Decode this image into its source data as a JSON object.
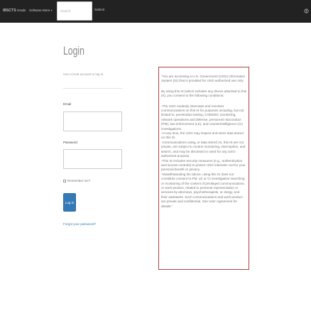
{
  "navbar": {
    "brand": "IBSCTS",
    "links": [
      "Grads",
      "Software",
      "More"
    ],
    "search_placeholder": "Search",
    "submit_label": "Submit",
    "help_icon": "help-circle-icon"
  },
  "login": {
    "title": "Login",
    "subtitle": "Use a local account to log in.",
    "email_label": "Email",
    "password_label": "Password",
    "remember_label": "Remember me?",
    "button_label": "Log in",
    "forgot_label": "Forgot your password?"
  },
  "notice": {
    "paragraphs": [
      "\"You are accessing a U.S. Government (USG) Information System (IS) that is provided for USG-authorized use only.",
      "By using this IS (which includes any device attached to this IS), you consent to the following conditions:",
      "-The USG routinely intercepts and monitors communications on this IS for purposes including, but not limited to, penetration testing, COMSEC monitoring, network operations and defense, personnel misconduct (PM), law enforcement (LE), and counterintelligence (CI) investigations.",
      "-At any time, the USG may inspect and seize data stored on this IS.",
      "-Communications using, or data stored on, this IS are not private, are subject to routine monitoring, interception, and search, and may be disclosed or used for any USG-authorized purpose.",
      "-This IS includes security measures (e.g., authentication and access controls) to protect USG interests--not for your personal benefit or privacy.",
      "-Notwithstanding the above, using this IS does not constitute consent to PM, LE or CI investigative searching or monitoring of the content of privileged communications, or work product, related to personal representation or services by attorneys, psychotherapists, or clergy, and their assistants. Such communications and work product are private and confidential. See User Agreement for details.\""
    ]
  },
  "colors": {
    "navbar_bg": "#222222",
    "primary": "#337ab7",
    "notice_border": "#a94442"
  }
}
